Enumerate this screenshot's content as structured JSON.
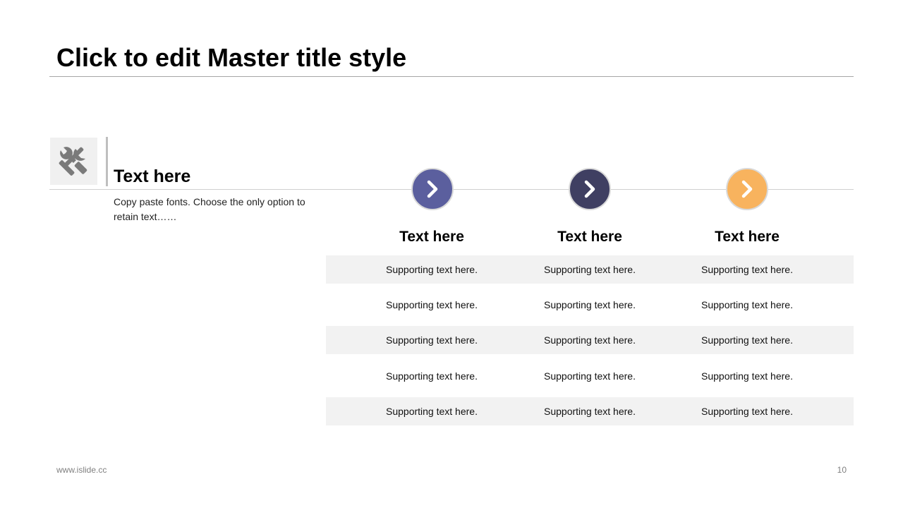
{
  "slide": {
    "title": "Click to edit Master title style"
  },
  "feature": {
    "icon": "tools-icon",
    "heading": "Text here",
    "body": "Copy paste fonts. Choose the only option to retain text……"
  },
  "columns": [
    {
      "icon": "chevron-right-icon",
      "color": "#5b5f9e",
      "heading": "Text here"
    },
    {
      "icon": "chevron-right-icon",
      "color": "#3f3f62",
      "heading": "Text here"
    },
    {
      "icon": "chevron-right-icon",
      "color": "#f8b35e",
      "heading": "Text here"
    }
  ],
  "table": {
    "rows": [
      [
        "Supporting text here.",
        "Supporting text here.",
        "Supporting text here."
      ],
      [
        "Supporting text here.",
        "Supporting text here.",
        "Supporting text here."
      ],
      [
        "Supporting text here.",
        "Supporting text here.",
        "Supporting text here."
      ],
      [
        "Supporting text here.",
        "Supporting text here.",
        "Supporting text here."
      ],
      [
        "Supporting text here.",
        "Supporting text here.",
        "Supporting text here."
      ]
    ]
  },
  "footer": {
    "url": "www.islide.cc",
    "page_number": "10"
  }
}
